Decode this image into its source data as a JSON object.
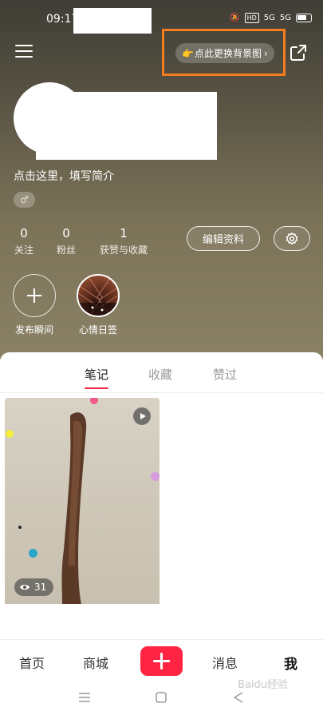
{
  "status_bar": {
    "time": "09:17",
    "hd": "HD",
    "sig1": "5G",
    "sig2": "5G"
  },
  "header": {
    "change_background_label": "点此更换背景图"
  },
  "profile": {
    "bio_placeholder": "点击这里，填写简介",
    "gender_symbol": "♂",
    "stats": [
      {
        "num": "0",
        "label": "关注"
      },
      {
        "num": "0",
        "label": "粉丝"
      },
      {
        "num": "1",
        "label": "获赞与收藏"
      }
    ],
    "edit_profile_label": "编辑资料"
  },
  "moments": [
    {
      "label": "发布瞬间"
    },
    {
      "label": "心情日签"
    }
  ],
  "tabs": [
    {
      "label": "笔记",
      "active": true
    },
    {
      "label": "收藏",
      "active": false
    },
    {
      "label": "赞过",
      "active": false
    }
  ],
  "note": {
    "views": "31"
  },
  "bottom_nav": [
    {
      "label": "首页"
    },
    {
      "label": "商城"
    },
    {
      "label": "消息"
    },
    {
      "label": "我"
    }
  ],
  "colors": {
    "accent": "#ff2442",
    "highlight_box": "#f57c1f"
  },
  "watermark": "Baidu经验"
}
